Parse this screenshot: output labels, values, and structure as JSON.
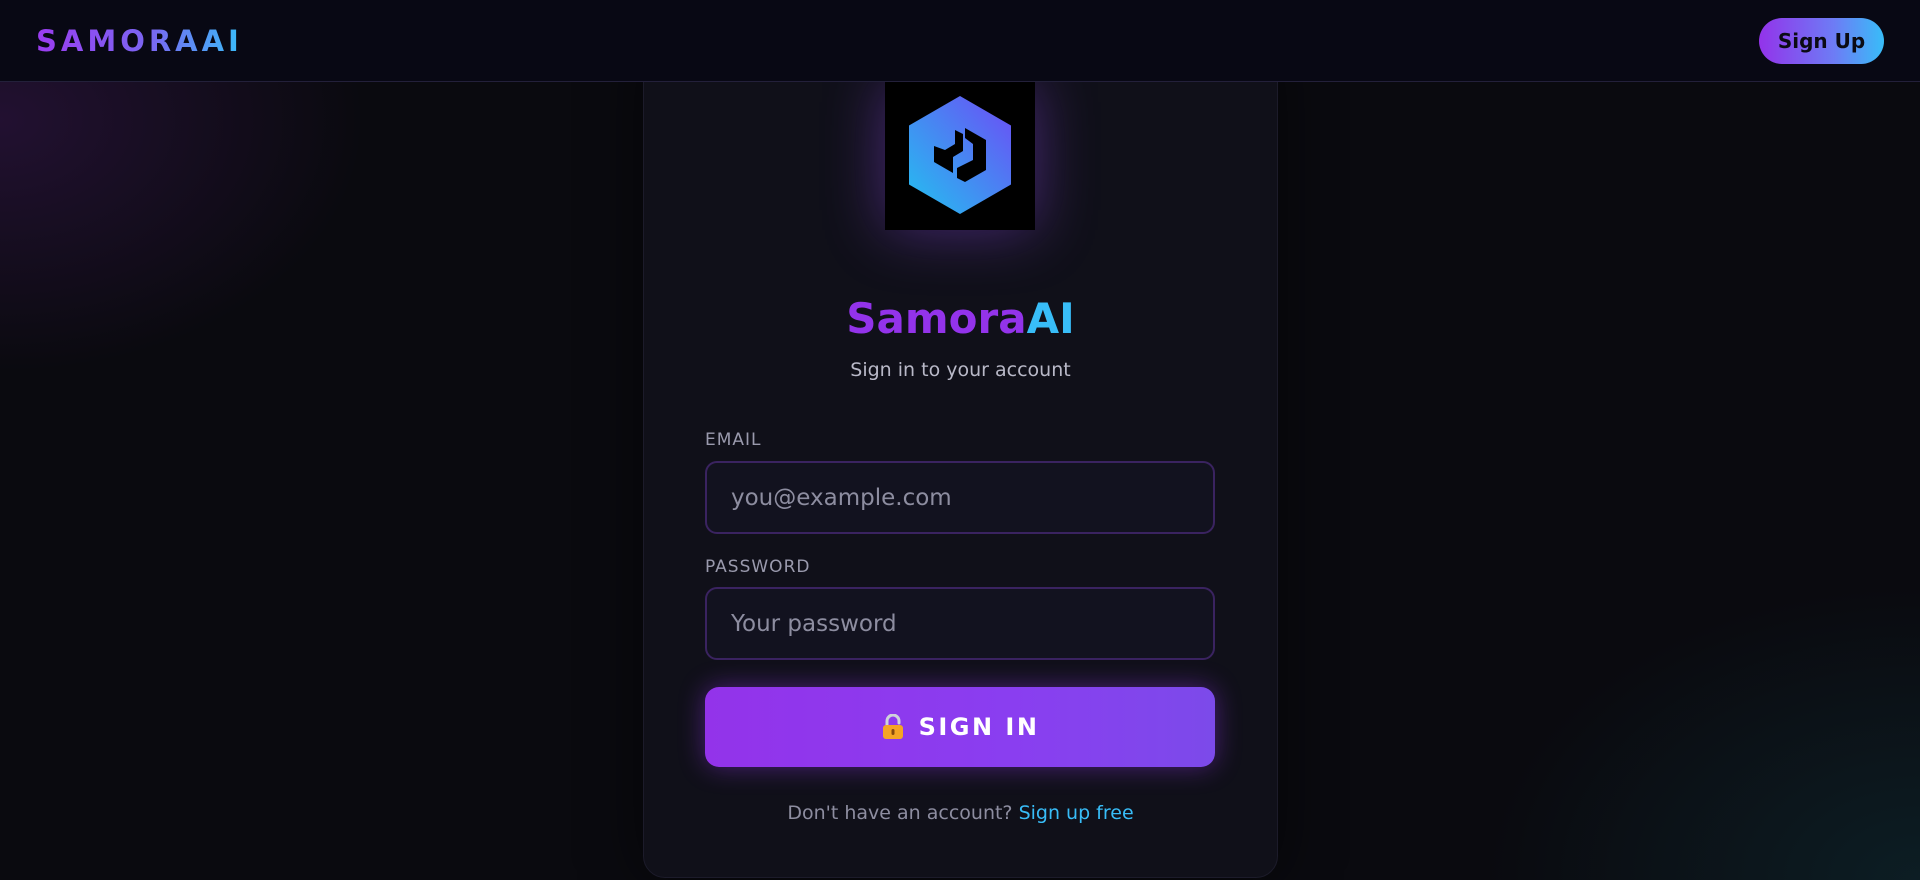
{
  "navbar": {
    "brand": "SAMORAAI",
    "signup_label": "Sign Up"
  },
  "logo": {
    "icon": "hexagon-logo-icon",
    "colors": [
      "#38bdf8",
      "#6d5cf5"
    ]
  },
  "card": {
    "title_part1": "Samora",
    "title_part2": "AI",
    "subtitle": "Sign in to your account"
  },
  "form": {
    "email_label": "EMAIL",
    "email_placeholder": "you@example.com",
    "email_value": "",
    "password_label": "PASSWORD",
    "password_placeholder": "Your password",
    "password_value": "",
    "submit_label": "SIGN IN",
    "submit_icon": "lock-icon"
  },
  "footer": {
    "prompt": "Don't have an account?",
    "link_label": "Sign up free"
  },
  "colors": {
    "accent_purple": "#9333ea",
    "accent_cyan": "#38bdf8",
    "background": "#0a0a0f",
    "card": "#101019"
  }
}
